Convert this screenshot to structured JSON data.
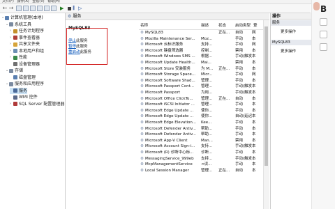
{
  "menu": [
    "文件(F)",
    "操作(A)",
    "查看(V)",
    "帮助(H)"
  ],
  "tree": [
    {
      "label": "计算机管理(本地)",
      "icon": "computer-icon",
      "indent": 0,
      "exp": "⌄"
    },
    {
      "label": "系统工具",
      "icon": "tools-icon",
      "indent": 1,
      "exp": "⌄"
    },
    {
      "label": "任务计划程序",
      "icon": "clock-icon",
      "indent": 2,
      "exp": "›"
    },
    {
      "label": "事件查看器",
      "icon": "event-viewer-icon",
      "indent": 2,
      "exp": "›"
    },
    {
      "label": "共享文件夹",
      "icon": "folder-icon",
      "indent": 2,
      "exp": "›"
    },
    {
      "label": "本地用户和组",
      "icon": "users-icon",
      "indent": 2,
      "exp": "›"
    },
    {
      "label": "性能",
      "icon": "performance-icon",
      "indent": 2,
      "exp": "›"
    },
    {
      "label": "设备管理器",
      "icon": "device-manager-icon",
      "indent": 2,
      "exp": ""
    },
    {
      "label": "存储",
      "icon": "storage-icon",
      "indent": 1,
      "exp": "⌄"
    },
    {
      "label": "磁盘管理",
      "icon": "disk-icon",
      "indent": 2,
      "exp": ""
    },
    {
      "label": "服务和应用程序",
      "icon": "apps-icon",
      "indent": 1,
      "exp": "⌄"
    },
    {
      "label": "服务",
      "icon": "gear-icon",
      "indent": 2,
      "exp": "",
      "selected": true
    },
    {
      "label": "WMI 控件",
      "icon": "wmi-icon",
      "indent": 2,
      "exp": ""
    },
    {
      "label": "SQL Server 配置管理器",
      "icon": "sql-icon",
      "indent": 2,
      "exp": "›"
    }
  ],
  "center_title": "服务",
  "desc": {
    "service_name": "MySQL83",
    "stop_link": "停止",
    "stop_rest": "此服务",
    "pause_link": "暂停",
    "pause_rest": "此服务",
    "restart_link": "重启动",
    "restart_rest": "此服务"
  },
  "columns": [
    "名称",
    "描述",
    "状态",
    "启动类型",
    "登"
  ],
  "services": [
    [
      "MySQL83",
      "",
      "正在...",
      "自动",
      "网"
    ],
    [
      "Mozilla Maintenance Ser...",
      "Moz...",
      "",
      "手动",
      "本"
    ],
    [
      "Microsoft 云标识服务",
      "支持...",
      "",
      "手动",
      "网"
    ],
    [
      "Microsoft 键盘筛选器",
      "控制...",
      "",
      "禁用",
      "本"
    ],
    [
      "Microsoft Windows SMS ...",
      "根据...",
      "",
      "手动(触发...",
      "本"
    ],
    [
      "Microsoft Update Health...",
      "Mai...",
      "",
      "禁用",
      "本"
    ],
    [
      "Microsoft Store 安装服务",
      "为 M...",
      "正在...",
      "手动",
      "本"
    ],
    [
      "Microsoft Storage Space...",
      "Micr...",
      "",
      "手动",
      "网"
    ],
    [
      "Microsoft Software Shad...",
      "管理...",
      "",
      "手动",
      "本"
    ],
    [
      "Microsoft Passport Cont...",
      "管理...",
      "",
      "手动(触发...",
      "本"
    ],
    [
      "Microsoft Passport",
      "为用...",
      "",
      "手动(触发...",
      "本"
    ],
    [
      "Microsoft Office ClickTo...",
      "管理...",
      "正在...",
      "自动",
      "本"
    ],
    [
      "Microsoft iSCSI Initiator ...",
      "管理...",
      "",
      "手动",
      "本"
    ],
    [
      "Microsoft Edge Update ...",
      "使你...",
      "",
      "手动",
      "本"
    ],
    [
      "Microsoft Edge Update ...",
      "使你...",
      "",
      "自动(延迟...",
      "本"
    ],
    [
      "Microsoft Edge Elevation...",
      "Kee...",
      "",
      "手动",
      "本"
    ],
    [
      "Microsoft Defender Antiv...",
      "帮助...",
      "",
      "手动",
      "本"
    ],
    [
      "Microsoft Defender Antiv...",
      "帮助...",
      "",
      "手动",
      "本"
    ],
    [
      "Microsoft App-V Client",
      "Man...",
      "",
      "禁用",
      "本"
    ],
    [
      "Microsoft Account Sign-i...",
      "支持...",
      "",
      "手动(触发...",
      "本"
    ],
    [
      "Microsoft (R) 诊断中心标...",
      "诊断...",
      "",
      "手动",
      "本"
    ],
    [
      "MessagingService_999eb",
      "支持...",
      "",
      "手动(触发...",
      "本"
    ],
    [
      "McpManagementService",
      "<读...",
      "",
      "手动",
      "本"
    ],
    [
      "Local Session Manager",
      "管理...",
      "正在...",
      "自动",
      "本"
    ]
  ],
  "actions": {
    "header": "操作",
    "sec1": "服务",
    "sec2": "MySQL83",
    "more": "更多操作"
  },
  "rside_letter": "B"
}
